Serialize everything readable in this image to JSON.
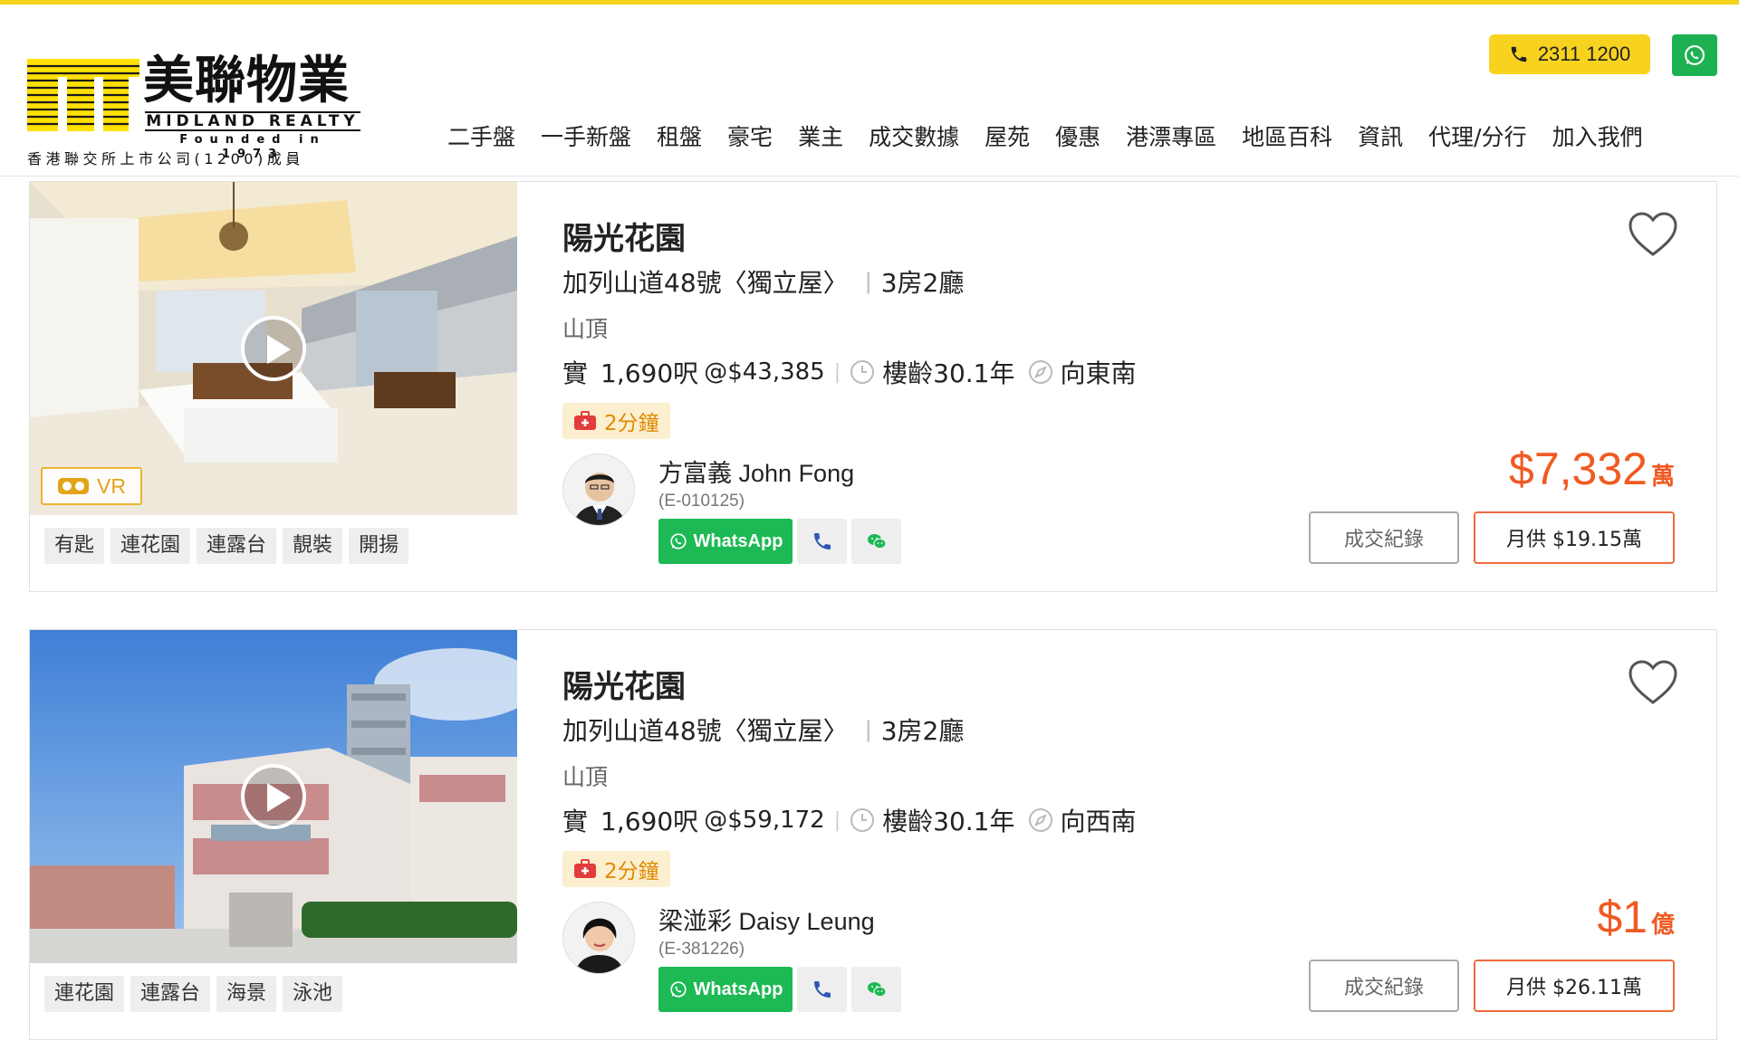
{
  "brand": {
    "name_cn": "美聯物業",
    "name_en": "MIDLAND REALTY",
    "founded": "Founded in 1973",
    "subtitle": "香港聯交所上市公司(1200)成員",
    "accent_color": "#f7d320"
  },
  "header": {
    "phone": "2311 1200",
    "whatsapp_icon": "whatsapp-icon",
    "nav": [
      "二手盤",
      "一手新盤",
      "租盤",
      "豪宅",
      "業主",
      "成交數據",
      "屋苑",
      "優惠",
      "港漂專區",
      "地區百科",
      "資訊",
      "代理/分行",
      "加入我們"
    ]
  },
  "listings": [
    {
      "title": "陽光花園",
      "address": "加列山道48號〈獨立屋〉",
      "layout": "3房2廳",
      "district": "山頂",
      "area_prefix": "實",
      "area": "1,690呎",
      "unit_price": "@$43,385",
      "age": "樓齡30.1年",
      "facing": "向東南",
      "travel_time": "2分鐘",
      "vr_label": "VR",
      "tags": [
        "有匙",
        "連花園",
        "連露台",
        "靚裝",
        "開揚"
      ],
      "agent": {
        "name_cn": "方富義",
        "name_en": "John Fong",
        "license": "(E-010125)"
      },
      "whatsapp_label": "WhatsApp",
      "price": "$7,332",
      "price_unit": "萬",
      "record_label": "成交紀錄",
      "mortgage_label": "月供 $19.15萬"
    },
    {
      "title": "陽光花園",
      "address": "加列山道48號〈獨立屋〉",
      "layout": "3房2廳",
      "district": "山頂",
      "area_prefix": "實",
      "area": "1,690呎",
      "unit_price": "@$59,172",
      "age": "樓齡30.1年",
      "facing": "向西南",
      "travel_time": "2分鐘",
      "tags": [
        "連花園",
        "連露台",
        "海景",
        "泳池"
      ],
      "agent": {
        "name_cn": "梁湴彩",
        "name_en": "Daisy Leung",
        "license": "(E-381226)"
      },
      "whatsapp_label": "WhatsApp",
      "price": "$1",
      "price_unit": "億",
      "record_label": "成交紀錄",
      "mortgage_label": "月供 $26.11萬"
    }
  ]
}
